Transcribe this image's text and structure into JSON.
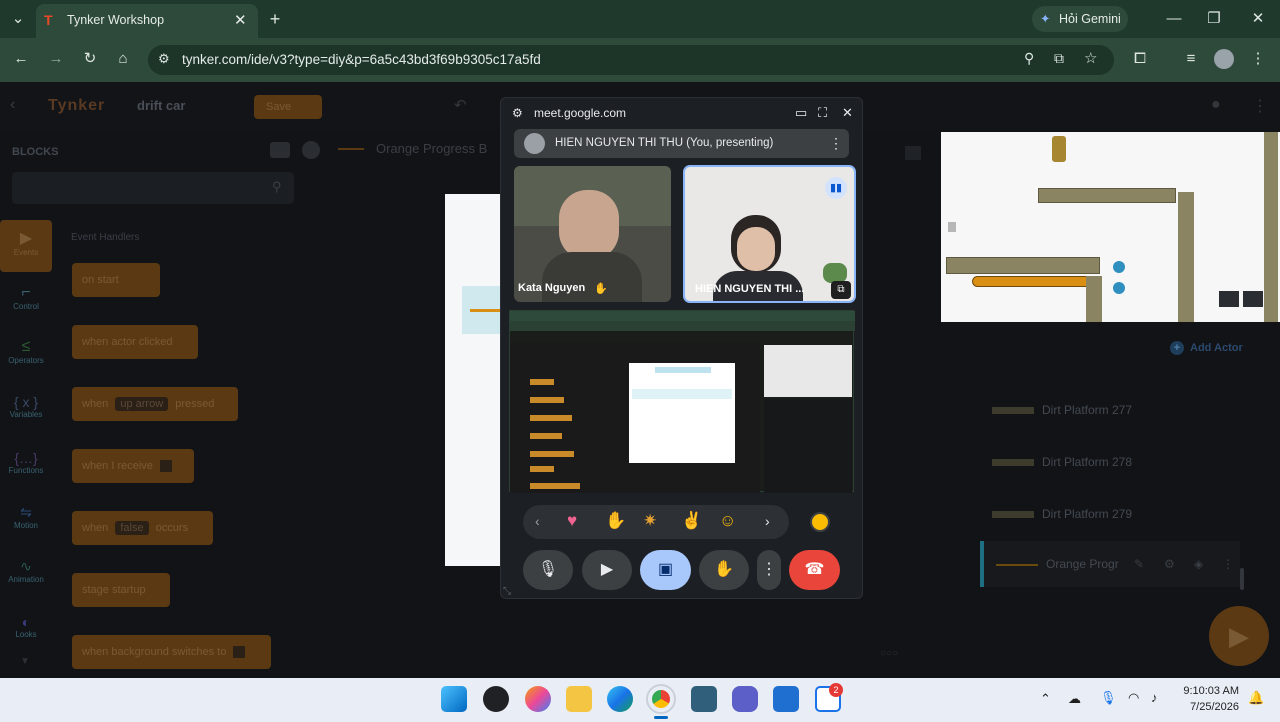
{
  "browser": {
    "tab_title": "Tynker Workshop",
    "url": "tynker.com/ide/v3?type=diy&p=6a5c43bd3f69b9305c17a5fd",
    "gemini_label": "Hỏi Gemini"
  },
  "tynker": {
    "logo": "Tynker",
    "project_name": "drift car",
    "save_label": "Save",
    "blocks_title": "BLOCKS",
    "event_handlers": "Event Handlers",
    "selected_actor": "Orange Progress B",
    "add_actor": "Add Actor",
    "blocks": [
      "on start",
      "when actor clicked",
      "when",
      "up arrow",
      "pressed",
      "when I receive",
      "when",
      "false",
      "occurs",
      "stage startup",
      "when background switches to"
    ],
    "categories": [
      "Events",
      "Control",
      "Operators",
      "Variables",
      "Functions",
      "Motion",
      "Animation",
      "Looks"
    ],
    "actors": [
      "Dirt Platform 277",
      "Dirt Platform 278",
      "Dirt Platform 279",
      "Orange Progr"
    ]
  },
  "meet": {
    "domain": "meet.google.com",
    "presenter": "HIEN NGUYEN THI THU (You, presenting)",
    "tile1_name": "Kata Nguyen",
    "tile2_name": "HIEN NGUYEN THI ..."
  },
  "taskbar": {
    "time": "9:10:03 AM",
    "date": "7/25/2026",
    "badge_count": "2"
  },
  "colors": {
    "chrome_green": "#2e4a3b",
    "meet_blue": "#a8c7fa",
    "hangup_red": "#e9453a",
    "tynker_orange": "#f5a623"
  }
}
